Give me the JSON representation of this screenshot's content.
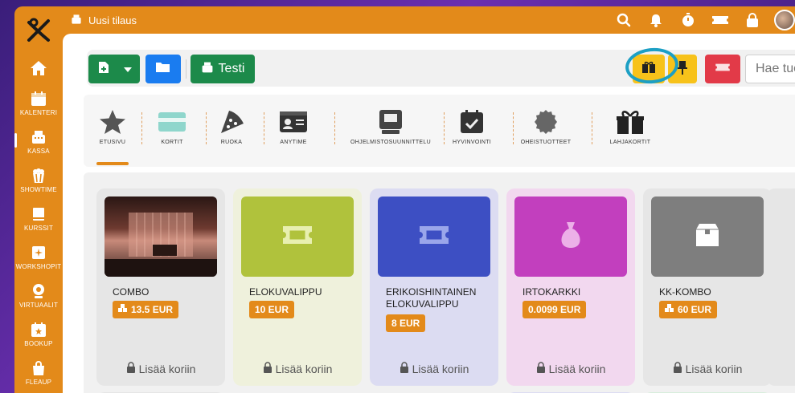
{
  "app": {
    "title": "Uusi tilaus"
  },
  "sidebar": {
    "items": [
      {
        "label": "",
        "icon": "home-icon"
      },
      {
        "label": "KALENTERI",
        "icon": "calendar-icon"
      },
      {
        "label": "KASSA",
        "icon": "cash-register-icon"
      },
      {
        "label": "SHOWTIME",
        "icon": "popcorn-icon"
      },
      {
        "label": "KURSSIT",
        "icon": "book-icon"
      },
      {
        "label": "WORKSHOPIT",
        "icon": "workshop-icon"
      },
      {
        "label": "VIRTUAALIT",
        "icon": "webcam-icon"
      },
      {
        "label": "BOOKUP",
        "icon": "calendar-star-icon"
      },
      {
        "label": "FLEAUP",
        "icon": "bag-icon"
      }
    ]
  },
  "toolbar": {
    "testi_label": "Testi",
    "search_placeholder": "Hae tuo"
  },
  "categories": [
    {
      "label": "ETUSIVU",
      "icon": "star-icon"
    },
    {
      "label": "KORTIT",
      "icon": "card-icon"
    },
    {
      "label": "RUOKA",
      "icon": "pizza-icon"
    },
    {
      "label": "ANYTIME",
      "icon": "id-card-icon"
    },
    {
      "label": "OHJELMISTOSUUNNITTELU",
      "icon": "computer-icon"
    },
    {
      "label": "HYVINVOINTI",
      "icon": "calendar-check-icon"
    },
    {
      "label": "OHEISTUOTTEET",
      "icon": "badge-icon"
    },
    {
      "label": "LAHJAKORTIT",
      "icon": "gift-icon"
    }
  ],
  "products": [
    {
      "name": "COMBO",
      "price": "13.5 EUR",
      "add": "Lisää koriin",
      "bg": "#e6e6e6",
      "img_bg": "#3a2420",
      "icon": "photo"
    },
    {
      "name": "ELOKUVALIPPU",
      "price": "10 EUR",
      "add": "Lisää koriin",
      "bg": "#eff1dc",
      "img_bg": "#b0c23c",
      "icon": "ticket-icon"
    },
    {
      "name": "ERIKOISHINTAINEN ELOKUVALIPPU",
      "price": "8 EUR",
      "add": "Lisää koriin",
      "bg": "#dcdcf2",
      "img_bg": "#3d4fc3",
      "icon": "ticket-icon"
    },
    {
      "name": "IRTOKARKKI",
      "price": "0.0099 EUR",
      "add": "Lisää koriin",
      "bg": "#f2d8ef",
      "img_bg": "#c23fbe",
      "icon": "candy-bag-icon"
    },
    {
      "name": "KK-KOMBO",
      "price": "60 EUR",
      "add": "Lisää koriin",
      "bg": "#e6e6e6",
      "img_bg": "#7e7e7e",
      "icon": "box-icon"
    }
  ],
  "colors": {
    "accent": "#e38a1a",
    "green": "#1c8a4a",
    "blue": "#1a7cf0",
    "yellow": "#f7c21a",
    "red": "#e23a48",
    "annotation": "#1c9fc4"
  }
}
